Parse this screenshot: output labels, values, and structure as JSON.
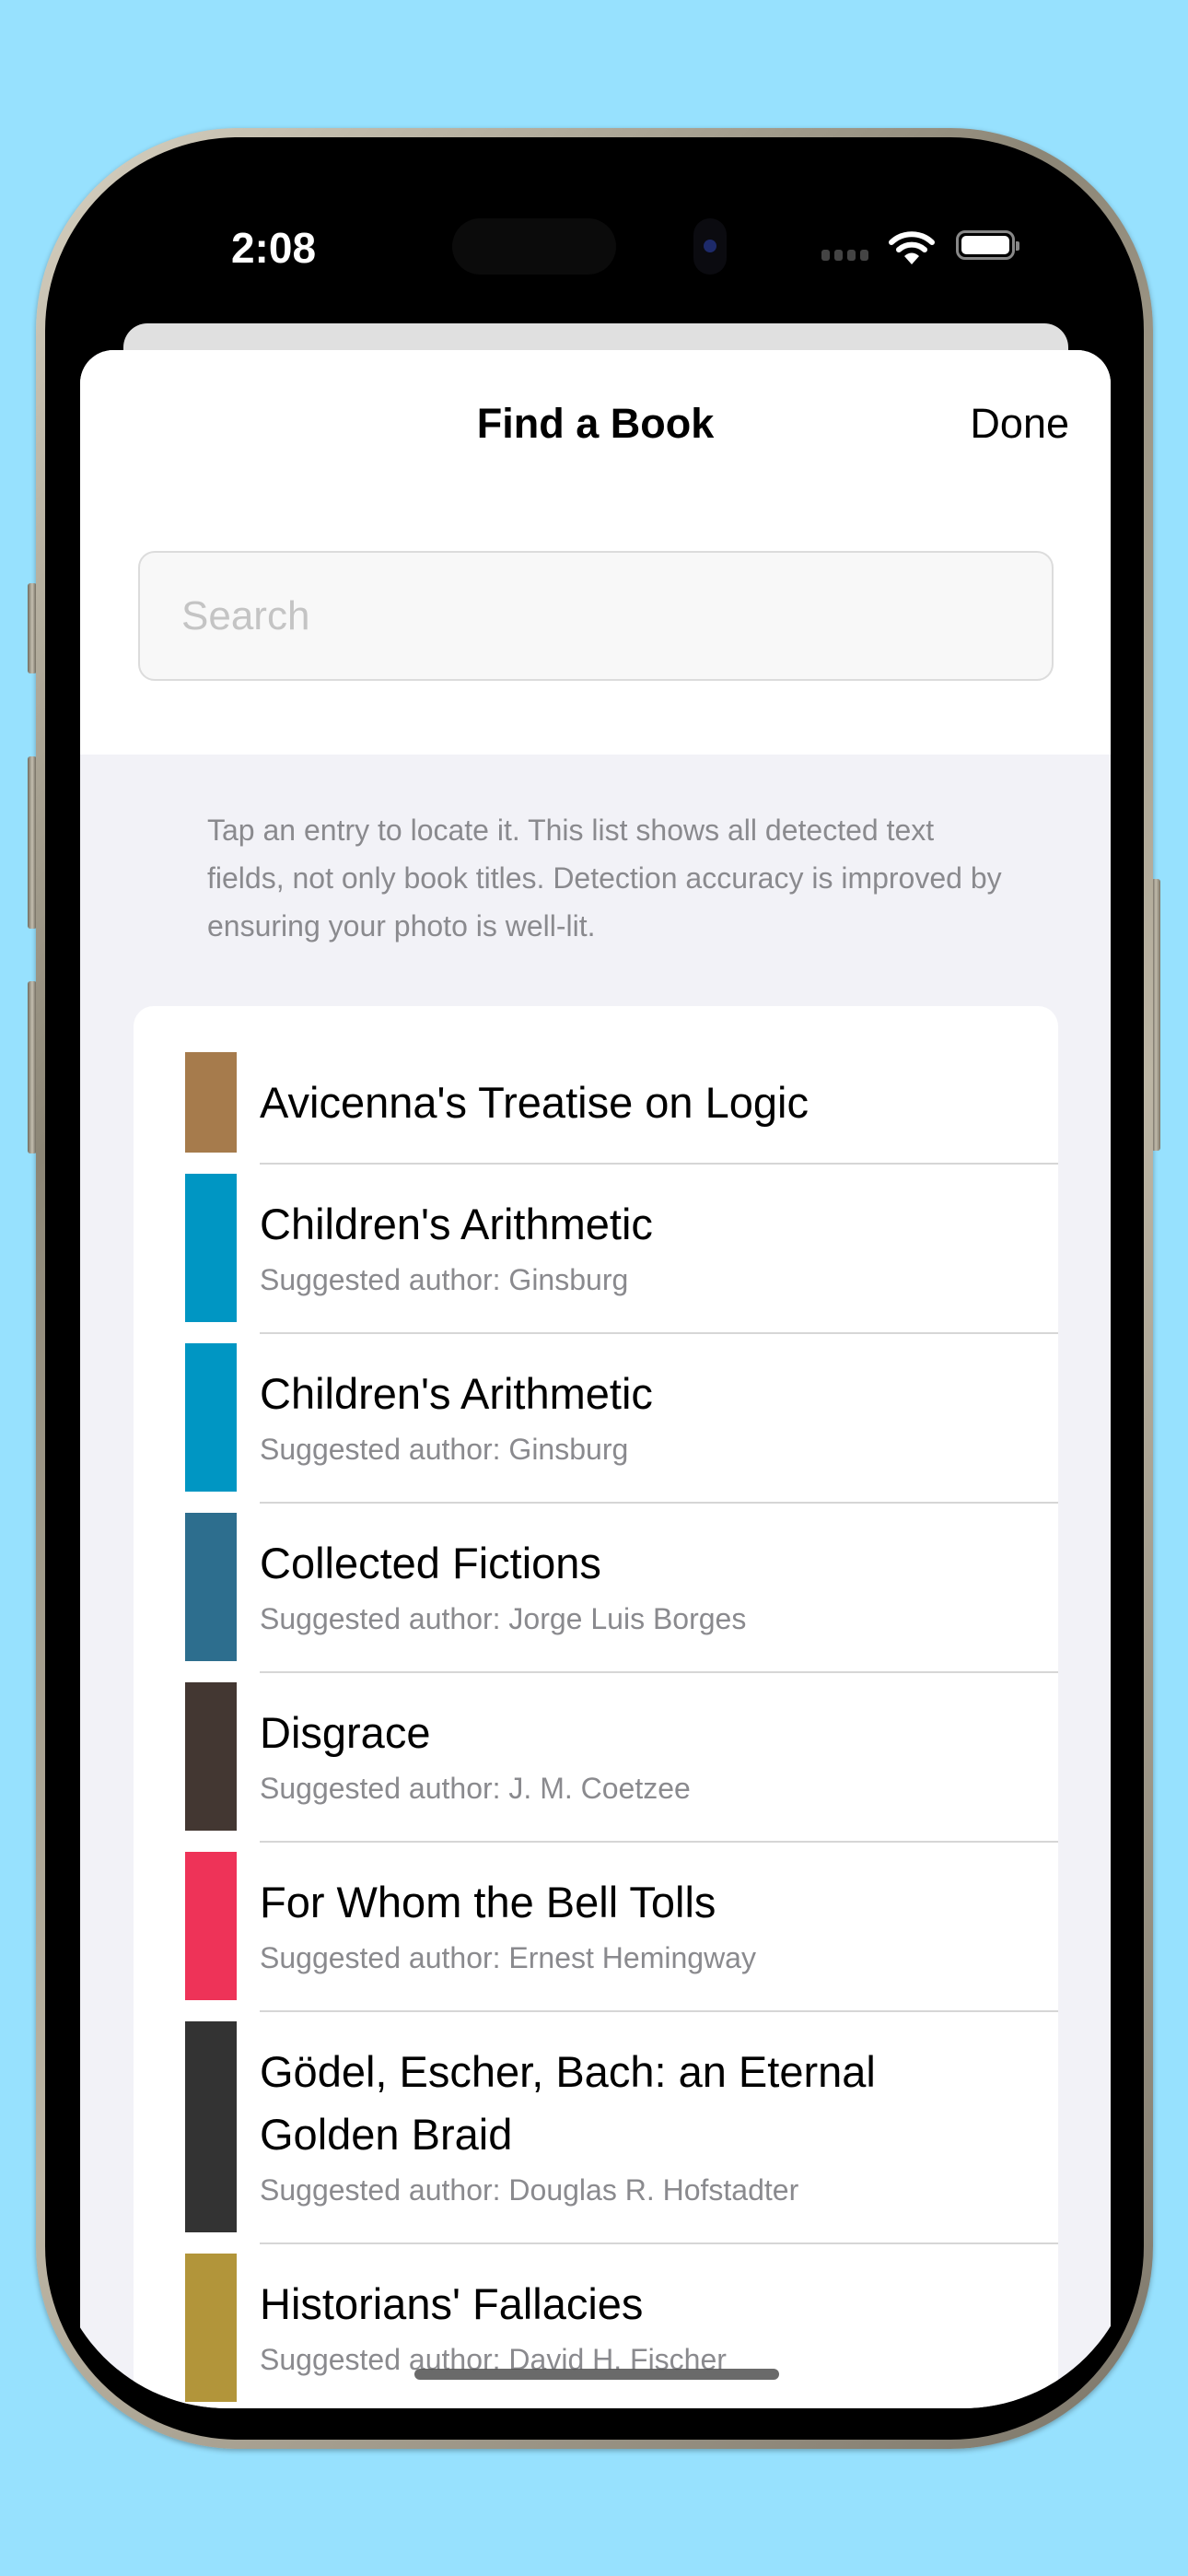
{
  "status_bar": {
    "time": "2:08",
    "icons": [
      "signal-dots-icon",
      "wifi-icon",
      "battery-icon"
    ]
  },
  "header": {
    "title": "Find a Book",
    "done_label": "Done"
  },
  "search": {
    "placeholder": "Search",
    "value": ""
  },
  "footer_note": "Tap an entry to locate it. This list shows all detected text fields, not only book titles. Detection accuracy is improved by ensuring your photo is well-lit.",
  "books": [
    {
      "title": "Avicenna's Treatise on Logic",
      "subtitle": "",
      "color": "#A67B4C"
    },
    {
      "title": "Children's Arithmetic",
      "subtitle": "Suggested author: Ginsburg",
      "color": "#0096C3"
    },
    {
      "title": "Children's Arithmetic",
      "subtitle": "Suggested author: Ginsburg",
      "color": "#0096C3"
    },
    {
      "title": "Collected Fictions",
      "subtitle": "Suggested author: Jorge Luis Borges",
      "color": "#2D6E8E"
    },
    {
      "title": "Disgrace",
      "subtitle": "Suggested author: J. M. Coetzee",
      "color": "#433732"
    },
    {
      "title": "For Whom the Bell Tolls",
      "subtitle": "Suggested author: Ernest Hemingway",
      "color": "#EE3358"
    },
    {
      "title": "Gödel, Escher, Bach: an Eternal Golden Braid",
      "subtitle": "Suggested author: Douglas R. Hofstadter",
      "color": "#333333"
    },
    {
      "title": "Historians' Fallacies",
      "subtitle": "Suggested author: David H. Fischer",
      "color": "#B2953A"
    }
  ]
}
